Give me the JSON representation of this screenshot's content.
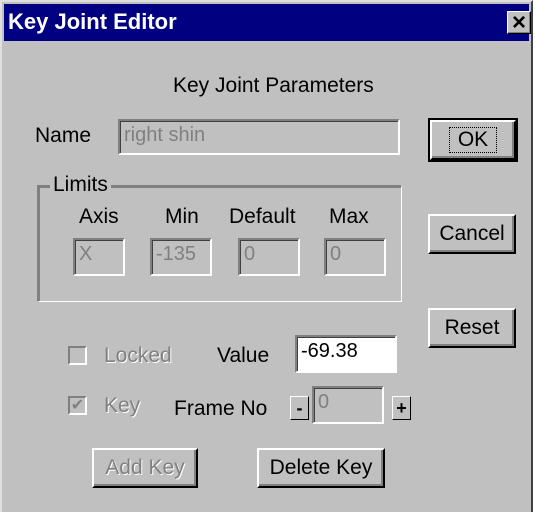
{
  "window": {
    "title": "Key Joint Editor",
    "close_glyph": "×"
  },
  "dialog": {
    "heading": "Key Joint Parameters",
    "name_label": "Name",
    "name_value": "right shin",
    "limits": {
      "title": "Limits",
      "columns": [
        "Axis",
        "Min",
        "Default",
        "Max"
      ],
      "values": {
        "axis": "X",
        "min": "-135",
        "default": "0",
        "max": "0"
      }
    },
    "buttons": {
      "ok": "OK",
      "cancel": "Cancel",
      "reset": "Reset",
      "add_key": "Add Key",
      "delete_key": "Delete Key"
    },
    "locked_label": "Locked",
    "locked_checked": false,
    "value_label": "Value",
    "value": "-69.38",
    "key_label": "Key",
    "key_checked": true,
    "frame_label": "Frame No",
    "frame_value": "0",
    "frame_minus": "-",
    "frame_plus": "+"
  },
  "colors": {
    "face": "#c0c0c0",
    "titlebar": "#000080",
    "disabled_text": "#808080"
  }
}
